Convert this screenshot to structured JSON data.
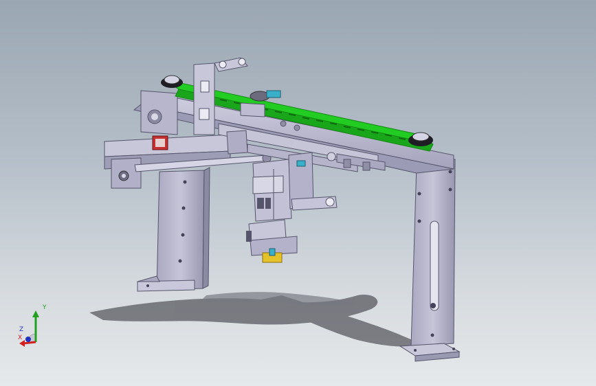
{
  "viewport": {
    "background_top": "#9aa6b2",
    "background_bottom": "#e6e9eb"
  },
  "model": {
    "colors": {
      "steel": "#b9b8cc",
      "steel_dark": "#8f8ea6",
      "steel_light": "#d8d8e8",
      "belt": "#22cc22",
      "belt_dark": "#138a13",
      "accent_red": "#c23030",
      "accent_yellow": "#e5c22a",
      "accent_cyan": "#3ab0c8",
      "shadow": "#2b2b33"
    }
  },
  "triad": {
    "x_label": "X",
    "y_label": "Y",
    "z_label": "Z",
    "x_color": "#d22020",
    "y_color": "#22a022",
    "z_color": "#2030c0"
  }
}
